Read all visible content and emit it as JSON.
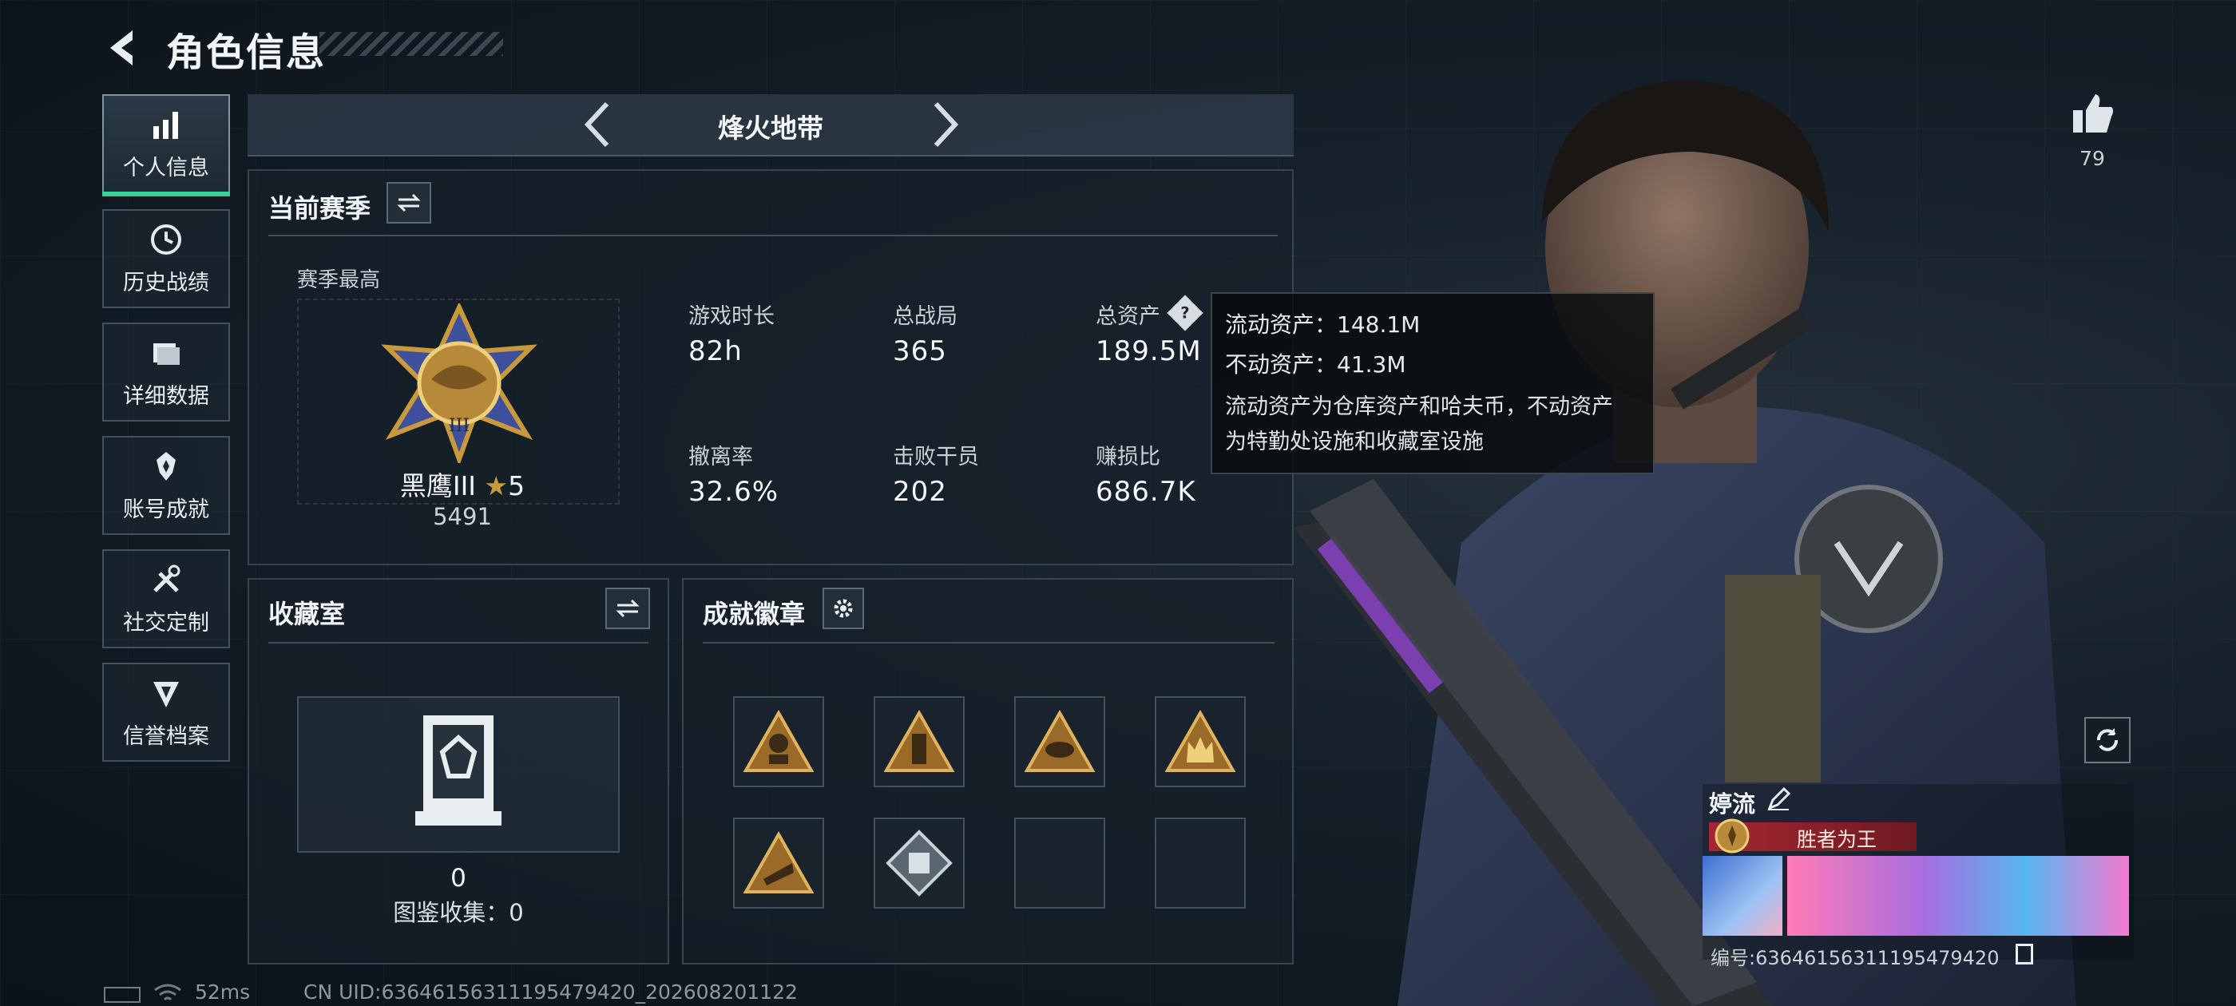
{
  "header": {
    "title": "角色信息"
  },
  "sidebar": {
    "items": [
      {
        "label": "个人信息",
        "icon": "bar-chart-icon",
        "active": true
      },
      {
        "label": "历史战绩",
        "icon": "clock-icon"
      },
      {
        "label": "详细数据",
        "icon": "folder-icon"
      },
      {
        "label": "账号成就",
        "icon": "achievement-icon"
      },
      {
        "label": "社交定制",
        "icon": "tools-icon"
      },
      {
        "label": "信誉档案",
        "icon": "shield-icon"
      }
    ]
  },
  "mode": {
    "title": "烽火地带"
  },
  "season": {
    "title": "当前赛季",
    "best_label": "赛季最高",
    "rank_name": "黑鹰III",
    "rank_stars": "5",
    "rank_score": "5491",
    "stats": [
      {
        "label": "游戏时长",
        "value": "82h"
      },
      {
        "label": "总战局",
        "value": "365"
      },
      {
        "label": "总资产",
        "value": "189.5M"
      },
      {
        "label": "撤离率",
        "value": "32.6%"
      },
      {
        "label": "击败干员",
        "value": "202"
      },
      {
        "label": "赚损比",
        "value": "686.7K"
      }
    ]
  },
  "tooltip": {
    "liquid": "流动资产：148.1M",
    "fixed": "不动资产：41.3M",
    "desc_line1": "流动资产为仓库资产和哈夫币，不动资产",
    "desc_line2": "为特勤处设施和收藏室设施"
  },
  "collection": {
    "title": "收藏室",
    "count": "0",
    "catalog": "图鉴收集：0"
  },
  "achievements": {
    "title": "成就徽章",
    "badges": [
      "soldier-badge",
      "tower-badge",
      "eye-badge",
      "crown-badge",
      "hand-badge",
      "chip-badge",
      "",
      ""
    ]
  },
  "profile": {
    "likes": "79",
    "name": "婷流",
    "title_tag": "胜者为王",
    "id_number": "编号:63646156311195479420"
  },
  "footer": {
    "ping": "52ms",
    "uid": "CN UID:63646156311195479420_202608201122"
  },
  "colors": {
    "accent": "#37d19b",
    "gold": "#c99a3c",
    "title_red": "#8a1e26"
  }
}
